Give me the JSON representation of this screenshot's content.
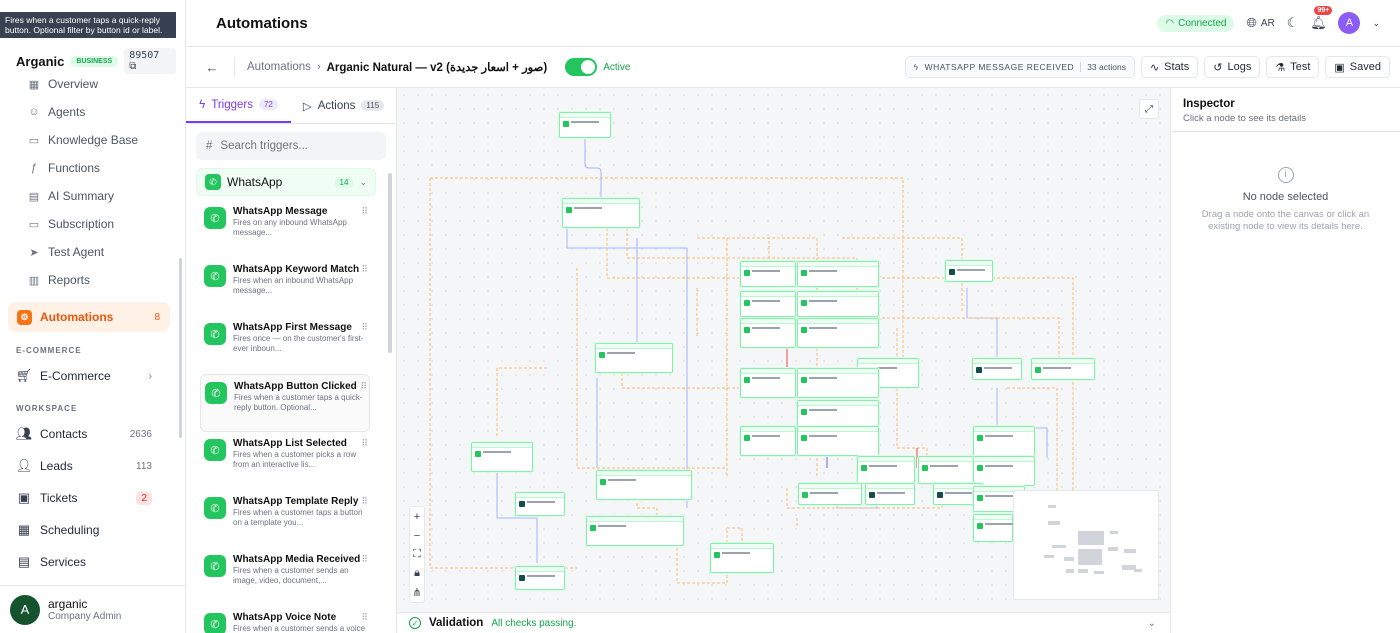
{
  "tooltip": "Fires when a customer taps a quick-reply button. Optional filter by button id or label.",
  "brand": {
    "name": "Arganic",
    "badge": "BUSINESS",
    "id": "89507"
  },
  "nav": {
    "items": [
      {
        "label": "Overview",
        "icon": "grid-icon"
      },
      {
        "label": "Agents",
        "icon": "agent-icon"
      },
      {
        "label": "Knowledge Base",
        "icon": "book-icon"
      },
      {
        "label": "Functions",
        "icon": "function-icon"
      },
      {
        "label": "AI Summary",
        "icon": "summary-icon"
      },
      {
        "label": "Subscription",
        "icon": "card-icon"
      },
      {
        "label": "Test Agent",
        "icon": "send-icon"
      },
      {
        "label": "Reports",
        "icon": "chart-icon"
      }
    ],
    "active": {
      "label": "Automations",
      "count": "8"
    },
    "ecommerce_label": "E-COMMERCE",
    "ecommerce_item": "E-Commerce",
    "workspace_label": "WORKSPACE",
    "workspace": [
      {
        "label": "Contacts",
        "count": "2636"
      },
      {
        "label": "Leads",
        "count": "113"
      },
      {
        "label": "Tickets",
        "count": "2"
      },
      {
        "label": "Scheduling",
        "count": ""
      },
      {
        "label": "Services",
        "count": ""
      }
    ]
  },
  "user": {
    "initial": "A",
    "name": "arganic",
    "role": "Company Admin"
  },
  "topbar": {
    "title": "Automations",
    "status": "Connected",
    "lang": "AR",
    "notif": "99+",
    "avatar": "A"
  },
  "subbar": {
    "crumb_parent": "Automations",
    "crumb_current": "Arganic Natural — v2 (صور + اسعار جديدة)",
    "active_label": "Active",
    "trigger_chip": "WHATSAPP MESSAGE RECEIVED",
    "actions_count": "33 actions",
    "buttons": {
      "stats": "Stats",
      "logs": "Logs",
      "test": "Test",
      "saved": "Saved"
    }
  },
  "panel": {
    "tab_triggers": "Triggers",
    "tab_triggers_count": "72",
    "tab_actions": "Actions",
    "tab_actions_count": "115",
    "search_placeholder": "Search triggers...",
    "group": {
      "name": "WhatsApp",
      "count": "14"
    },
    "triggers": [
      {
        "title": "WhatsApp Message",
        "desc": "Fires on any inbound WhatsApp message..."
      },
      {
        "title": "WhatsApp Keyword Match",
        "desc": "Fires when an inbound WhatsApp message..."
      },
      {
        "title": "WhatsApp First Message",
        "desc": "Fires once — on the customer's first-ever inboun..."
      },
      {
        "title": "WhatsApp Button Clicked",
        "desc": "Fires when a customer taps a quick-reply button. Optional..."
      },
      {
        "title": "WhatsApp List Selected",
        "desc": "Fires when a customer picks a row from an interactive lis..."
      },
      {
        "title": "WhatsApp Template Reply",
        "desc": "Fires when a customer taps a button on a template you..."
      },
      {
        "title": "WhatsApp Media Received",
        "desc": "Fires when a customer sends an image, video, document,..."
      },
      {
        "title": "WhatsApp Voice Note",
        "desc": "Fires when a customer sends a voice note."
      }
    ]
  },
  "validation": {
    "title": "Validation",
    "status": "All checks passing."
  },
  "inspector": {
    "title": "Inspector",
    "subtitle": "Click a node to see its details",
    "empty_title": "No node selected",
    "empty_desc": "Drag a node onto the canvas or click an existing node to view its details here."
  }
}
